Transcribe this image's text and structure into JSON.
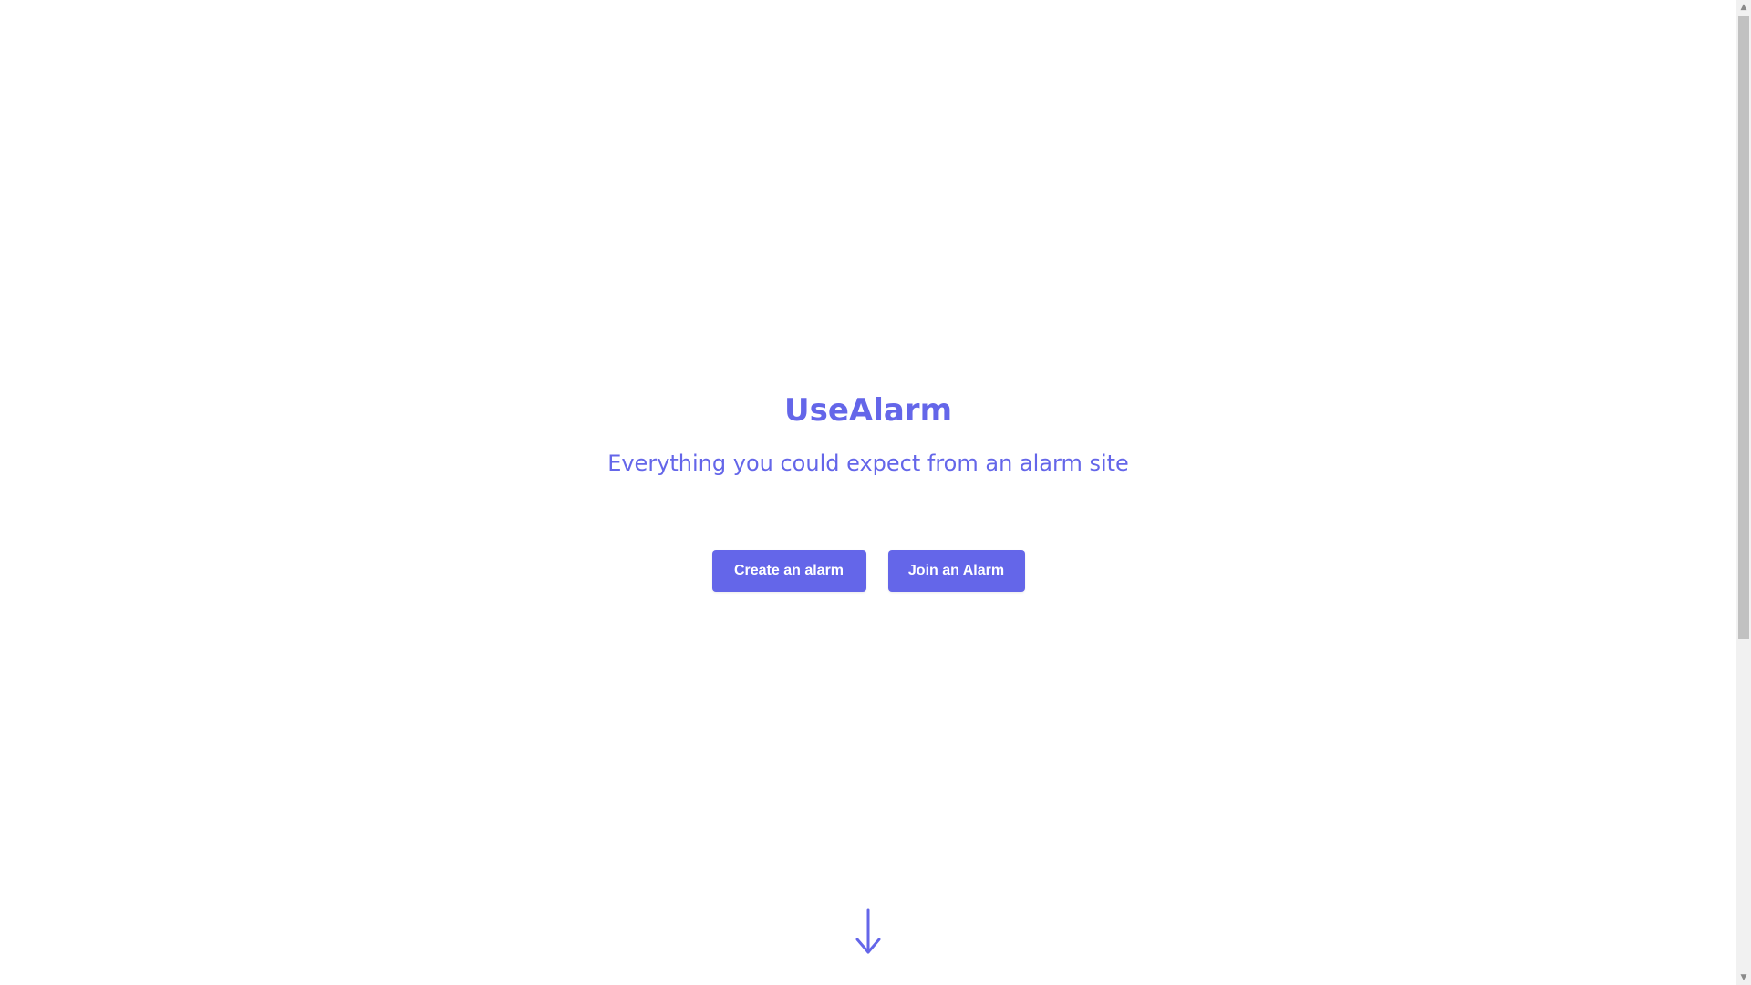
{
  "hero": {
    "title": "UseAlarm",
    "subtitle": "Everything you could expect from an alarm site"
  },
  "actions": {
    "create_label": "Create an alarm",
    "join_label": "Join an Alarm"
  },
  "icons": {
    "scroll_hint": "arrow-down-icon",
    "scroll_up": "triangle-up-icon",
    "scroll_down": "triangle-down-icon"
  },
  "colors": {
    "accent": "#6466e9",
    "button_text": "#ffffff",
    "background": "#ffffff",
    "scrollbar_track": "#f1f1f1",
    "scrollbar_thumb": "#c1c1c1"
  }
}
